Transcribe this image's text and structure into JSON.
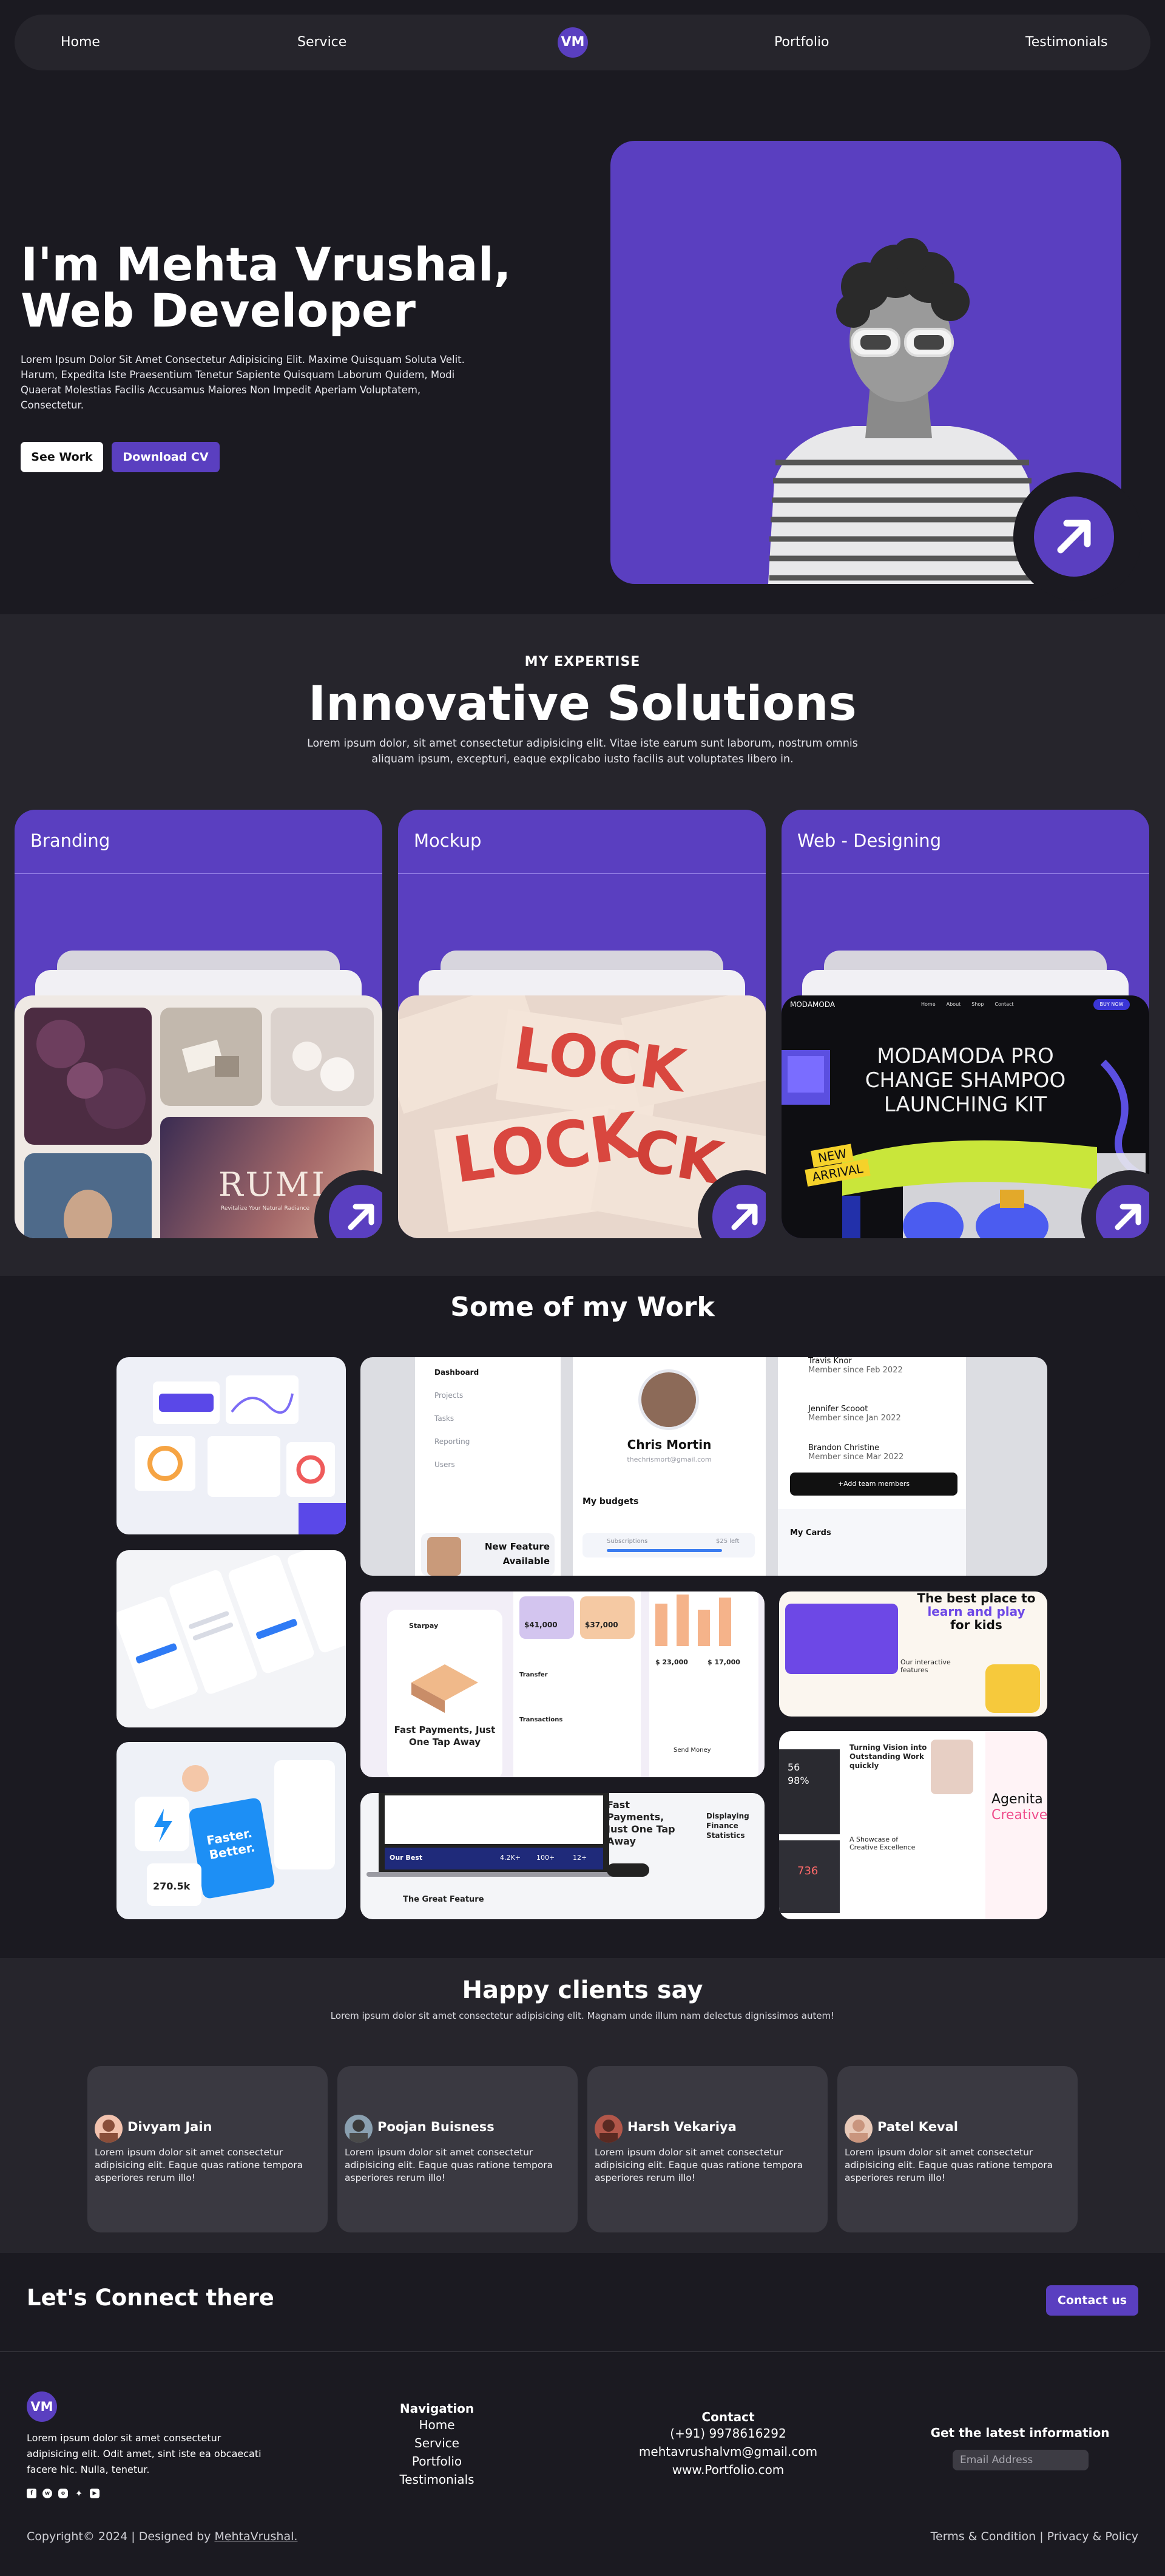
{
  "nav": {
    "items": [
      "Home",
      "Service",
      "Portfolio",
      "Testimonials"
    ],
    "logo": "VM"
  },
  "hero": {
    "title_line1": "I'm Mehta Vrushal,",
    "title_line2": "Web Developer",
    "description": "Lorem Ipsum Dolor Sit Amet Consectetur Adipisicing Elit. Maxime Quisquam Soluta Velit. Harum, Expedita Iste Praesentium Tenetur Sapiente Quisquam Laborum Quidem, Modi Quaerat Molestias Facilis Accusamus Maiores Non Impedit Aperiam Voluptatem, Consectetur.",
    "btn_work": "See Work",
    "btn_cv": "Download CV"
  },
  "expertise": {
    "kicker": "MY EXPERTISE",
    "title": "Innovative Solutions",
    "lead": "Lorem ipsum dolor, sit amet consectetur adipisicing elit. Vitae iste earum sunt laborum, nostrum omnis aliquam ipsum, excepturi, eaque explicabo iusto facilis aut voluptates libero in.",
    "cards": [
      {
        "title": "Branding",
        "brand_text": "RUMI",
        "brand_sub": "Revitalize Your Natural Radiance"
      },
      {
        "title": "Mockup",
        "mock_word": "LOCK",
        "mock_word2": "LOCK"
      },
      {
        "title": "Web - Designing",
        "site_brand": "MODAMODA",
        "site_menu": [
          "Home",
          "About",
          "Shop",
          "Contact"
        ],
        "site_cta": "BUY NOW",
        "headline": "MODAMODA PRO",
        "headline2": "CHANGE SHAMPOO",
        "headline3": "LAUNCHING KIT",
        "badge1": "NEW",
        "badge2": "ARRIVAL"
      }
    ]
  },
  "work": {
    "title": "Some of my Work",
    "dash": {
      "menu": [
        "Dashboard",
        "Projects",
        "Tasks",
        "Reporting",
        "Users"
      ],
      "profile_name": "Chris Mortin",
      "profile_email": "thechrismort@gmail.com",
      "budgets": "My budgets",
      "subscriptions": "Subscriptions",
      "sub_left": "$25 left",
      "feature_line1": "New Feature",
      "feature_line2": "Available",
      "members": [
        {
          "name": "Travis Knor",
          "since": "Member since Feb 2022"
        },
        {
          "name": "Jennifer Scooot",
          "since": "Member since Jan 2022"
        },
        {
          "name": "Brandon Christine",
          "since": "Member since Mar 2022"
        }
      ],
      "add_team": "+Add team members",
      "my_cards": "My Cards"
    },
    "pay": {
      "brand": "Starpay",
      "headline": "Fast Payments, Just One Tap Away",
      "amount1": "$41,000",
      "amount2": "$37,000",
      "amount3": "$ 23,000",
      "amount4": "$ 17,000",
      "transfer": "Transfer",
      "transactions": "Transactions",
      "send_money": "Send Money"
    },
    "kids": {
      "line1": "The best place to",
      "line2": "learn and play",
      "line3": "for kids",
      "features": "Our interactive features"
    },
    "vision": {
      "headline": "Turning Vision into Outstanding Work quickly",
      "stat1": "56",
      "stat2": "98%",
      "num": "736",
      "showcase": "A Showcase of Creative Excellence",
      "brand": "Agenita",
      "brand2": "Creative"
    },
    "lap": {
      "our_best": "Our Best",
      "stat1": "4.2K+",
      "stat2": "100+",
      "stat3": "12+",
      "great": "The Great Feature",
      "fast": "Fast Payments, Just One Tap Away",
      "display": "Displaying Finance Statistics"
    },
    "cards_shot": {
      "faster": "Faster. Better.",
      "stat": "270.5k"
    }
  },
  "testimonials": {
    "title": "Happy clients say",
    "sub": "Lorem ipsum dolor sit amet consectetur adipisicing elit. Magnam unde illum nam delectus dignissimos autem!",
    "items": [
      {
        "name": "Divyam Jain",
        "text": "Lorem ipsum dolor sit amet consectetur adipisicing elit. Eaque quas ratione tempora asperiores rerum illo!"
      },
      {
        "name": "Poojan Buisness",
        "text": "Lorem ipsum dolor sit amet consectetur adipisicing elit. Eaque quas ratione tempora asperiores rerum illo!"
      },
      {
        "name": "Harsh Vekariya",
        "text": "Lorem ipsum dolor sit amet consectetur adipisicing elit. Eaque quas ratione tempora asperiores rerum illo!"
      },
      {
        "name": "Patel Keval",
        "text": "Lorem ipsum dolor sit amet consectetur adipisicing elit. Eaque quas ratione tempora asperiores rerum illo!"
      }
    ]
  },
  "connect": {
    "title": "Let's Connect there",
    "button": "Contact us"
  },
  "footer": {
    "logo": "VM",
    "desc": "Lorem ipsum dolor sit amet consectetur adipisicing elit. Odit amet, sint iste ea obcaecati facere hic. Nulla, tenetur.",
    "nav_title": "Navigation",
    "nav_items": [
      "Home",
      "Service",
      "Portfolio",
      "Testimonials"
    ],
    "contact_title": "Contact",
    "phone": "(+91) 9978616292",
    "email": "mehtavrushalvm@gmail.com",
    "site": "www.Portfolio.com",
    "news_title": "Get the latest information",
    "email_placeholder": "Email Address",
    "copyright": "Copyright© 2024 | Designed by ",
    "designer": "MehtaVrushal.",
    "terms": "Terms & Condition | Privacy & Policy"
  },
  "colors": {
    "bg": "#1b1a21",
    "panel": "#26252c",
    "accent": "#5a3fc0",
    "card": "#3a3941"
  }
}
